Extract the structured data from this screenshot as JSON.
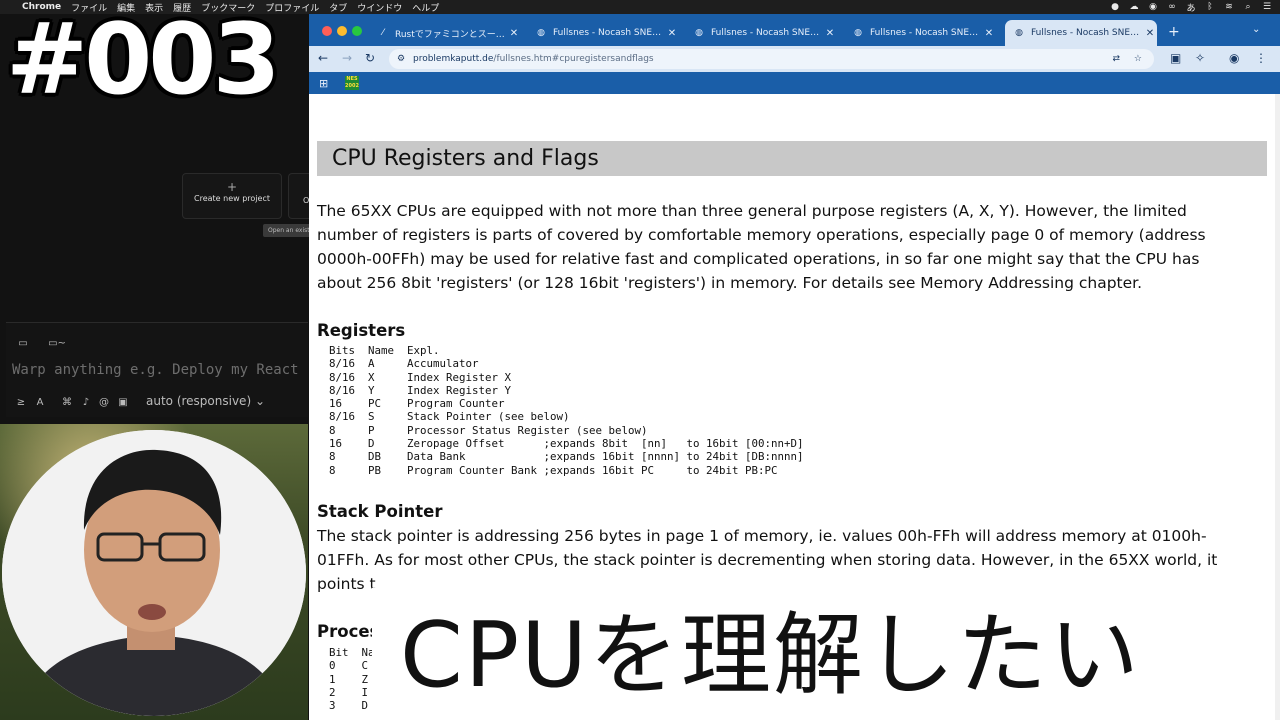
{
  "menubar": {
    "app": "Chrome",
    "items": [
      "ファイル",
      "編集",
      "表示",
      "履歴",
      "ブックマーク",
      "プロファイル",
      "タブ",
      "ウインドウ",
      "ヘルプ"
    ],
    "status_icons": [
      "record-icon",
      "cloud-icon",
      "color-icon",
      "creative-cloud-icon",
      "ime-icon",
      "bluetooth-icon",
      "wifi-icon",
      "search-icon",
      "control-center-icon"
    ],
    "ime_label": "あ"
  },
  "warp": {
    "new_project_label": "Create new project",
    "second_card_label": "O",
    "tooltip": "Open an exist",
    "folder_label": "~",
    "prompt_placeholder": "Warp anything e.g. Deploy my React",
    "mode_label": "auto (responsive)"
  },
  "browser": {
    "tabs": [
      {
        "title": "Rustでファミコンとスーパーファミ",
        "icon": "warp-icon",
        "active": false
      },
      {
        "title": "Fullsnes - Nocash SNES Spec",
        "icon": "globe-icon",
        "active": false
      },
      {
        "title": "Fullsnes - Nocash SNES Spec",
        "icon": "globe-icon",
        "active": false
      },
      {
        "title": "Fullsnes - Nocash SNES Spec",
        "icon": "globe-icon",
        "active": false
      },
      {
        "title": "Fullsnes - Nocash SNES Spec",
        "icon": "globe-icon",
        "active": true
      }
    ],
    "url_host": "problemkaputt.de",
    "url_path": "/fullsnes.htm#cpuregistersandflags",
    "bookmark_logo": "NES 2002",
    "colors": {
      "tabstrip": "#1a5ea8",
      "toolbar": "#d9e6f5",
      "heading_bg": "#c8c8c8"
    }
  },
  "page": {
    "title": "CPU Registers and Flags",
    "intro": "The 65XX CPUs are equipped with not more than three general purpose registers (A, X, Y). However, the limited number of registers is parts of covered by comfortable memory operations, especially page 0 of memory (address 0000h-00FFh) may be used for relative fast and complicated operations, in so far one might say that the CPU has about 256 8bit 'registers' (or 128 16bit 'registers') in memory. For details see Memory Addressing chapter.",
    "registers_heading": "Registers",
    "registers_table": "Bits  Name  Expl.\n8/16  A     Accumulator\n8/16  X     Index Register X\n8/16  Y     Index Register Y\n16    PC    Program Counter\n8/16  S     Stack Pointer (see below)\n8     P     Processor Status Register (see below)\n16    D     Zeropage Offset      ;expands 8bit  [nn]   to 16bit [00:nn+D]\n8     DB    Data Bank            ;expands 16bit [nnnn] to 24bit [DB:nnnn]\n8     PB    Program Counter Bank ;expands 16bit PC     to 24bit PB:PC",
    "stack_heading": "Stack Pointer",
    "stack_text": "The stack pointer is addressing 256 bytes in page 1 of memory, ie. values 00h-FFh will address memory at 0100h-01FFh. As for most other CPUs, the stack pointer is decrementing when storing data. However, in the 65XX world, it points t",
    "status_heading": "Proces",
    "status_table": "Bit  Na\n0    C\n1    Z\n2    I\n3    D"
  },
  "overlay": {
    "episode": "#003",
    "subtitle": "CPUを理解したい"
  }
}
